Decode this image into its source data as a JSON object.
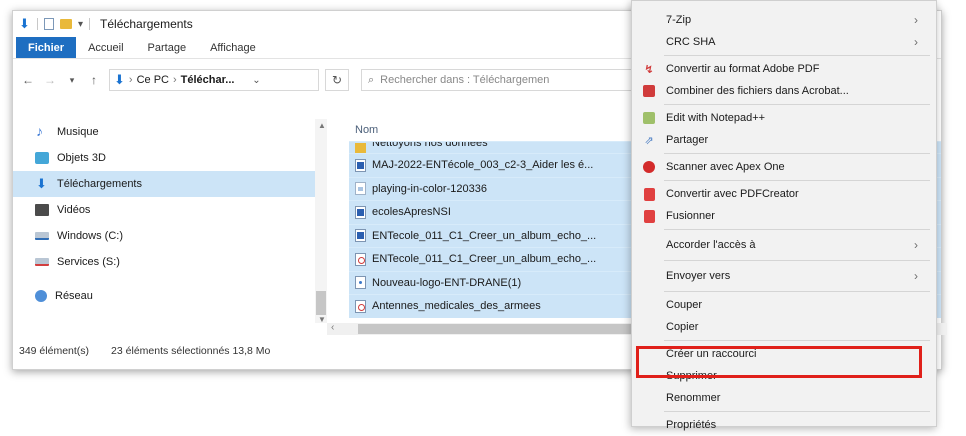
{
  "window": {
    "title": "Téléchargements",
    "ribbon_tabs": [
      "Fichier",
      "Accueil",
      "Partage",
      "Affichage"
    ],
    "address": {
      "root": "Ce PC",
      "separator": "›",
      "current": "Téléchar..."
    },
    "search_placeholder": "Rechercher dans : Téléchargemen",
    "column_name_header": "Nom"
  },
  "nav_pane": {
    "items": [
      {
        "label": "Musique",
        "icon": "music-icon"
      },
      {
        "label": "Objets 3D",
        "icon": "objects-3d-icon"
      },
      {
        "label": "Téléchargements",
        "icon": "downloads-icon",
        "selected": true
      },
      {
        "label": "Vidéos",
        "icon": "videos-icon"
      },
      {
        "label": "Windows (C:)",
        "icon": "drive-icon"
      },
      {
        "label": "Services (S:)",
        "icon": "network-drive-icon"
      },
      {
        "label": "Réseau",
        "icon": "network-icon"
      }
    ]
  },
  "files": [
    {
      "name": "Nettoyons nos données",
      "type": "folder"
    },
    {
      "name": "MAJ-2022-ENTécole_003_c2-3_Aider les é...",
      "type": "word"
    },
    {
      "name": "playing-in-color-120336",
      "type": "image"
    },
    {
      "name": "ecolesApresNSI",
      "type": "word"
    },
    {
      "name": "ENTecole_011_C1_Creer_un_album_echo_...",
      "type": "word"
    },
    {
      "name": "ENTecole_011_C1_Creer_un_album_echo_...",
      "type": "pdf"
    },
    {
      "name": "Nouveau-logo-ENT-DRANE(1)",
      "type": "dot"
    },
    {
      "name": "Antennes_medicales_des_armees",
      "type": "pdf"
    }
  ],
  "status": {
    "count": "349 élément(s)",
    "selection": "23 éléments sélectionnés  13,8 Mo"
  },
  "context_menu": {
    "items": [
      {
        "label": "7-Zip",
        "has_submenu": true
      },
      {
        "label": "CRC SHA",
        "has_submenu": true
      },
      {
        "label": "Convertir au format Adobe PDF",
        "icon": "adobe-pdf-icon"
      },
      {
        "label": "Combiner des fichiers dans Acrobat...",
        "icon": "acrobat-combine-icon"
      },
      {
        "label": "Edit with Notepad++",
        "icon": "notepad-plus-icon"
      },
      {
        "label": "Partager",
        "icon": "share-icon"
      },
      {
        "label": "Scanner avec Apex One",
        "icon": "apex-one-icon"
      },
      {
        "label": "Convertir avec PDFCreator",
        "icon": "pdfcreator-icon"
      },
      {
        "label": "Fusionner",
        "icon": "merge-pdf-icon"
      },
      {
        "label": "Accorder l'accès à",
        "has_submenu": true
      },
      {
        "label": "Envoyer vers",
        "has_submenu": true
      },
      {
        "label": "Couper"
      },
      {
        "label": "Copier"
      },
      {
        "label": "Créer un raccourci"
      },
      {
        "label": "Supprimer",
        "highlighted": true
      },
      {
        "label": "Renommer"
      },
      {
        "label": "Propriétés"
      }
    ]
  },
  "colors": {
    "ribbon_file_tab": "#1e6ec1",
    "selection": "#cce4f7",
    "highlight_box": "#e0201a"
  }
}
